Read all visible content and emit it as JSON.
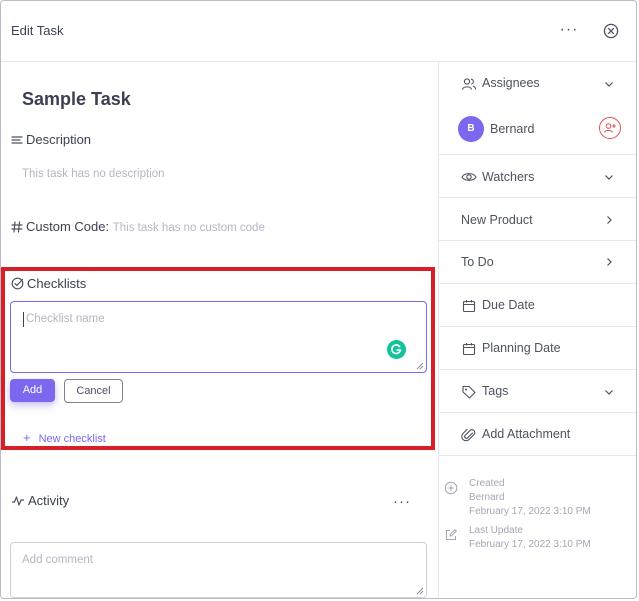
{
  "header": {
    "title": "Edit Task",
    "more": "···"
  },
  "task": {
    "title": "Sample Task",
    "description_label": "Description",
    "description_empty": "This task has no description",
    "custom_code_label": "Custom Code:",
    "custom_code_empty": "This task has no custom code"
  },
  "checklists": {
    "label": "Checklists",
    "input_placeholder": "Checklist name",
    "add_label": "Add",
    "cancel_label": "Cancel",
    "new_checklist_label": "New checklist"
  },
  "activity": {
    "label": "Activity",
    "more": "···",
    "comment_placeholder": "Add comment"
  },
  "sidebar": {
    "assignees_label": "Assignees",
    "assignee": {
      "initial": "B",
      "name": "Bernard"
    },
    "watchers_label": "Watchers",
    "project_label": "New Product",
    "status_label": "To Do",
    "due_date_label": "Due Date",
    "planning_date_label": "Planning Date",
    "tags_label": "Tags",
    "add_attachment_label": "Add Attachment",
    "created_label": "Created",
    "created_by": "Bernard",
    "created_at": "February 17, 2022 3:10 PM",
    "updated_label": "Last Update",
    "updated_at": "February 17, 2022 3:10 PM"
  },
  "colors": {
    "accent": "#7b68ee",
    "highlight_border": "#d81f26",
    "grammarly": "#15c39a",
    "add_user_outline": "#e05252"
  }
}
